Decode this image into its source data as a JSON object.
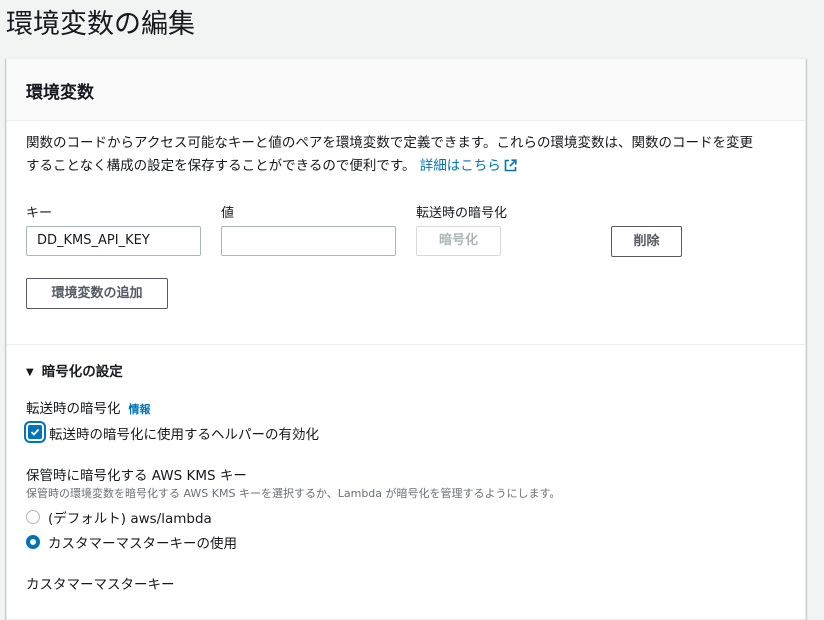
{
  "page": {
    "title": "環境変数の編集"
  },
  "panel": {
    "title": "環境変数",
    "description_line1": "関数のコードからアクセス可能なキーと値のペアを環境変数で定義できます。これらの環境変数は、関数のコードを変更",
    "description_line2": "することなく構成の設定を保存することができるので便利です。",
    "learn_more": "詳細はこちら",
    "external_icon": "external-link-icon"
  },
  "env_table": {
    "key_header": "キー",
    "value_header": "値",
    "encrypt_header": "転送時の暗号化",
    "rows": [
      {
        "key": "DD_KMS_API_KEY",
        "value": "",
        "encrypt_label": "暗号化",
        "remove_label": "削除"
      }
    ],
    "add_label": "環境変数の追加"
  },
  "encryption": {
    "section_label": "暗号化の設定",
    "transit_label": "転送時の暗号化",
    "info_label": "情報",
    "helper_checkbox_label": "転送時の暗号化に使用するヘルパーの有効化",
    "helper_checked": true,
    "kms_label": "保管時に暗号化する AWS KMS キー",
    "kms_description": "保管時の環境変数を暗号化する AWS KMS キーを選択するか、Lambda が暗号化を管理するようにします。",
    "options": [
      {
        "label": "(デフォルト) aws/lambda",
        "selected": false
      },
      {
        "label": "カスタマーマスターキーの使用",
        "selected": true
      }
    ],
    "cmk_label": "カスタマーマスターキー"
  },
  "colors": {
    "accent": "#0073bb",
    "text": "#16191f",
    "border": "#aab7b8"
  }
}
